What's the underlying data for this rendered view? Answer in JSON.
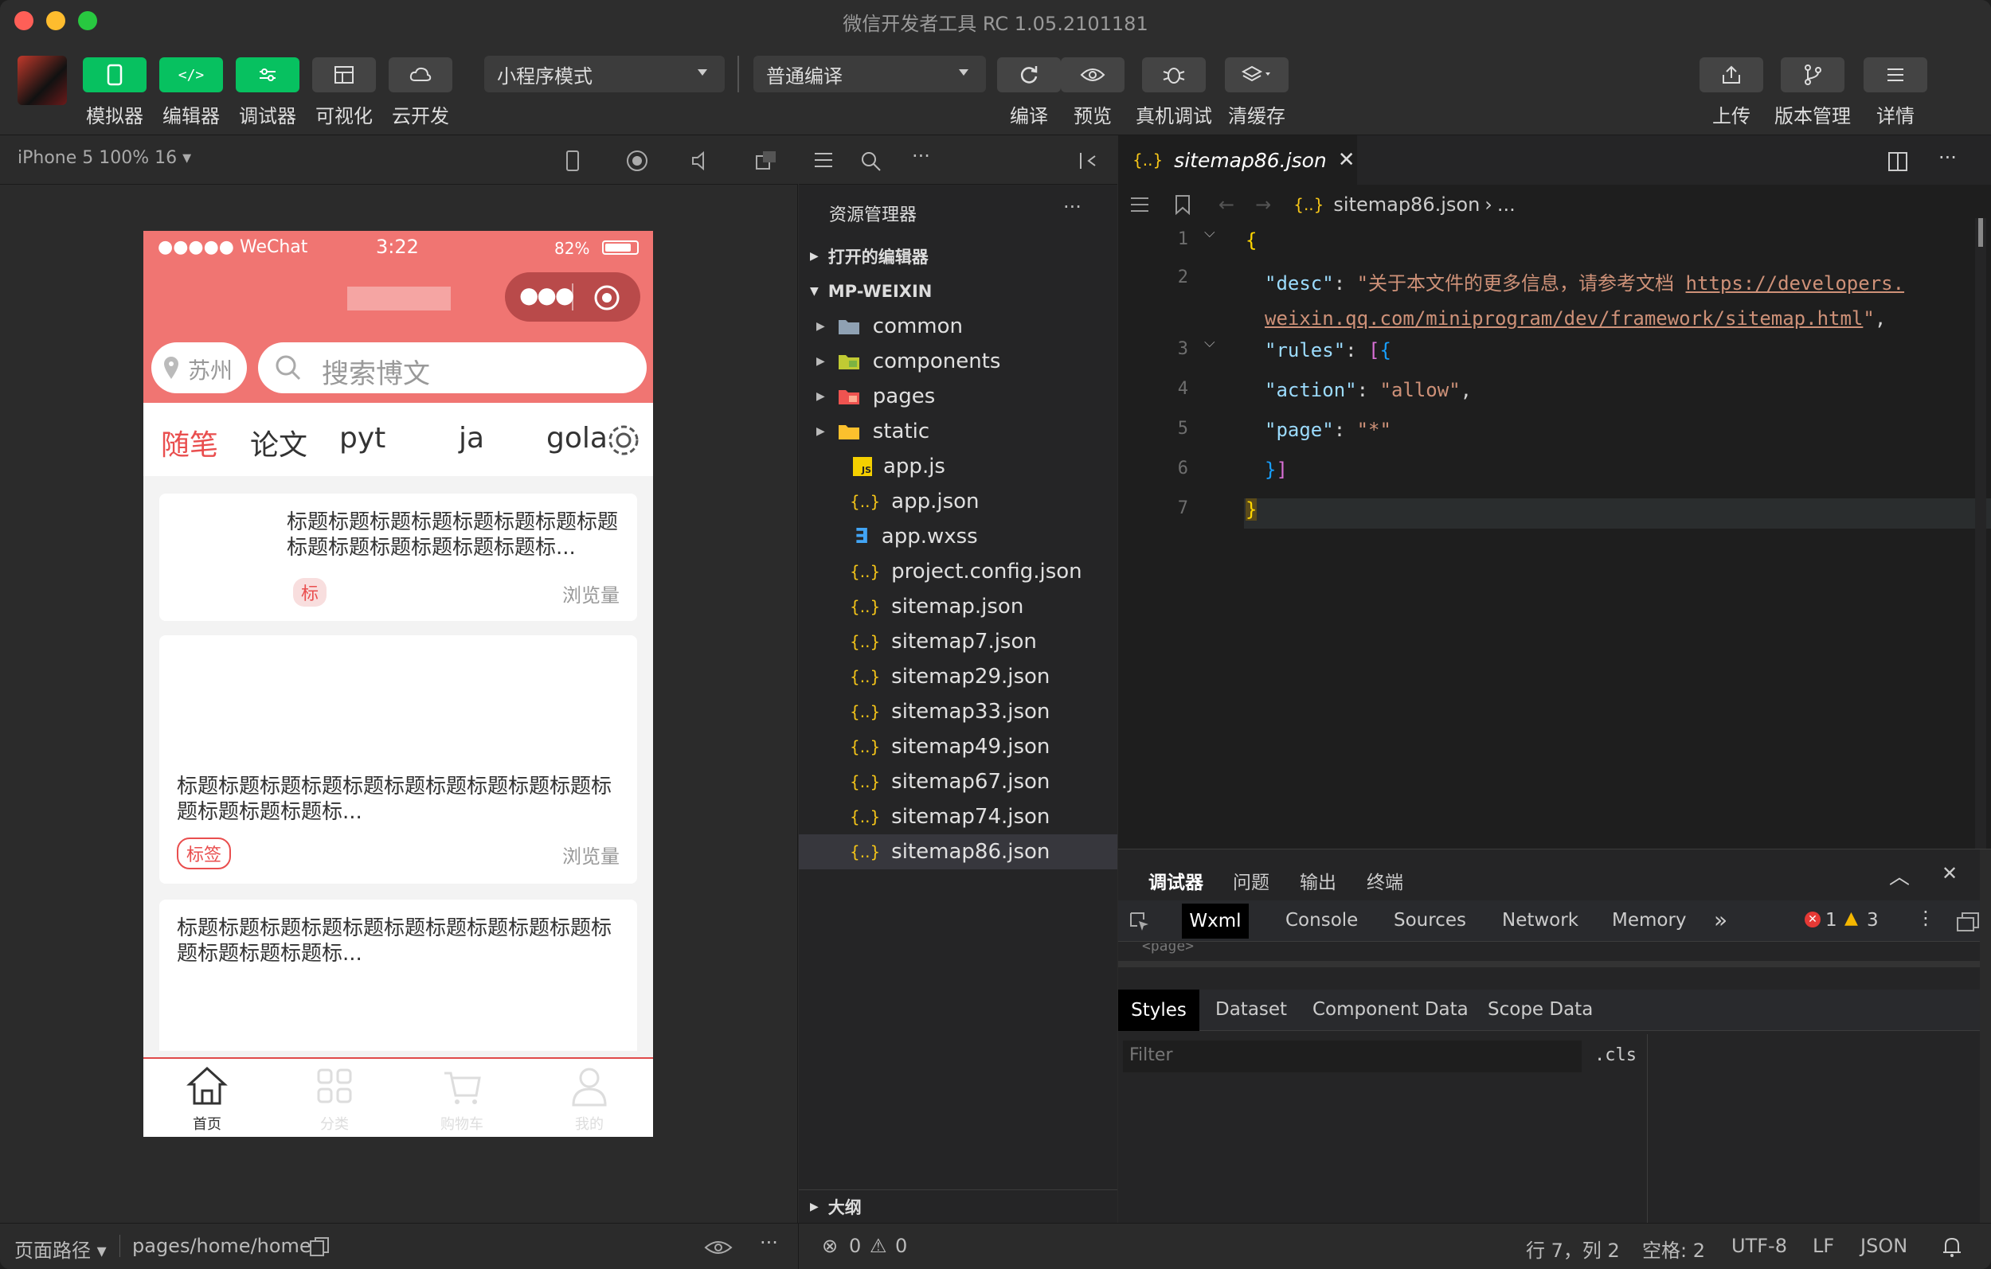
{
  "window": {
    "title": "微信开发者工具 RC 1.05.2101181"
  },
  "toolbar": {
    "simulator": "模拟器",
    "editor": "编辑器",
    "debugger": "调试器",
    "visual": "可视化",
    "cloud": "云开发",
    "mode": "小程序模式",
    "compile_mode": "普通编译",
    "compile": "编译",
    "preview": "预览",
    "real_debug": "真机调试",
    "clear_cache": "清缓存",
    "upload": "上传",
    "version": "版本管理",
    "details": "详情"
  },
  "simbar": {
    "device": "iPhone 5 100% 16 ▾"
  },
  "phone": {
    "carrier": "●●●●● WeChat",
    "time": "3:22",
    "battery": "82%",
    "location": "苏州",
    "search_placeholder": "搜索博文",
    "tabs": [
      "随笔",
      "论文",
      "pyt",
      "ja",
      "gola"
    ],
    "cards": [
      {
        "title": "标题标题标题标题标题标题标题标题标题标题标题标题标题标题标...",
        "tag": "标",
        "views": "浏览量"
      },
      {
        "title": "标题标题标题标题标题标题标题标题标题标题标题标题标题标题标...",
        "tag": "标签",
        "views": "浏览量"
      },
      {
        "title": "标题标题标题标题标题标题标题标题标题标题标题标题标题标题标..."
      }
    ],
    "tabbar": [
      "首页",
      "分类",
      "购物车",
      "我的"
    ]
  },
  "explorer": {
    "title": "资源管理器",
    "open_editors": "打开的编辑器",
    "project": "MP-WEIXIN",
    "folders": [
      "common",
      "components",
      "pages",
      "static"
    ],
    "files": [
      "app.js",
      "app.json",
      "app.wxss",
      "project.config.json",
      "sitemap.json",
      "sitemap7.json",
      "sitemap29.json",
      "sitemap33.json",
      "sitemap49.json",
      "sitemap67.json",
      "sitemap74.json",
      "sitemap86.json"
    ],
    "outline": "大纲"
  },
  "editor": {
    "tab": "sitemap86.json",
    "breadcrumb": "sitemap86.json",
    "breadcrumb_more": "...",
    "line_numbers": [
      "1",
      "2",
      "3",
      "4",
      "5",
      "6",
      "7"
    ],
    "desc_key": "\"desc\"",
    "desc_text": "\"关于本文件的更多信息，请参考文档 ",
    "url1": "https://developers.",
    "url2": "weixin.qq.com/miniprogram/dev/framework/sitemap.html",
    "rules_key": "\"rules\"",
    "action_key": "\"action\"",
    "action_val": "\"allow\"",
    "page_key": "\"page\"",
    "page_val": "\"*\""
  },
  "debug": {
    "tabs": [
      "调试器",
      "问题",
      "输出",
      "终端"
    ],
    "devtabs": [
      "Wxml",
      "Console",
      "Sources",
      "Network",
      "Memory"
    ],
    "errors": "1",
    "warnings": "3",
    "styletabs": [
      "Styles",
      "Dataset",
      "Component Data",
      "Scope Data"
    ],
    "filter_placeholder": "Filter",
    "cls": ".cls",
    "page_tag": "<page>"
  },
  "status": {
    "path_label": "页面路径 ▾",
    "path": "pages/home/home",
    "errors": "0",
    "warnings": "0",
    "cursor": "行 7，列 2",
    "spaces": "空格: 2",
    "encoding": "UTF-8",
    "eol": "LF",
    "lang": "JSON"
  },
  "colors": {
    "accent": "#07c160",
    "phone_header": "#f07572",
    "tab_active": "#e94e4e"
  }
}
